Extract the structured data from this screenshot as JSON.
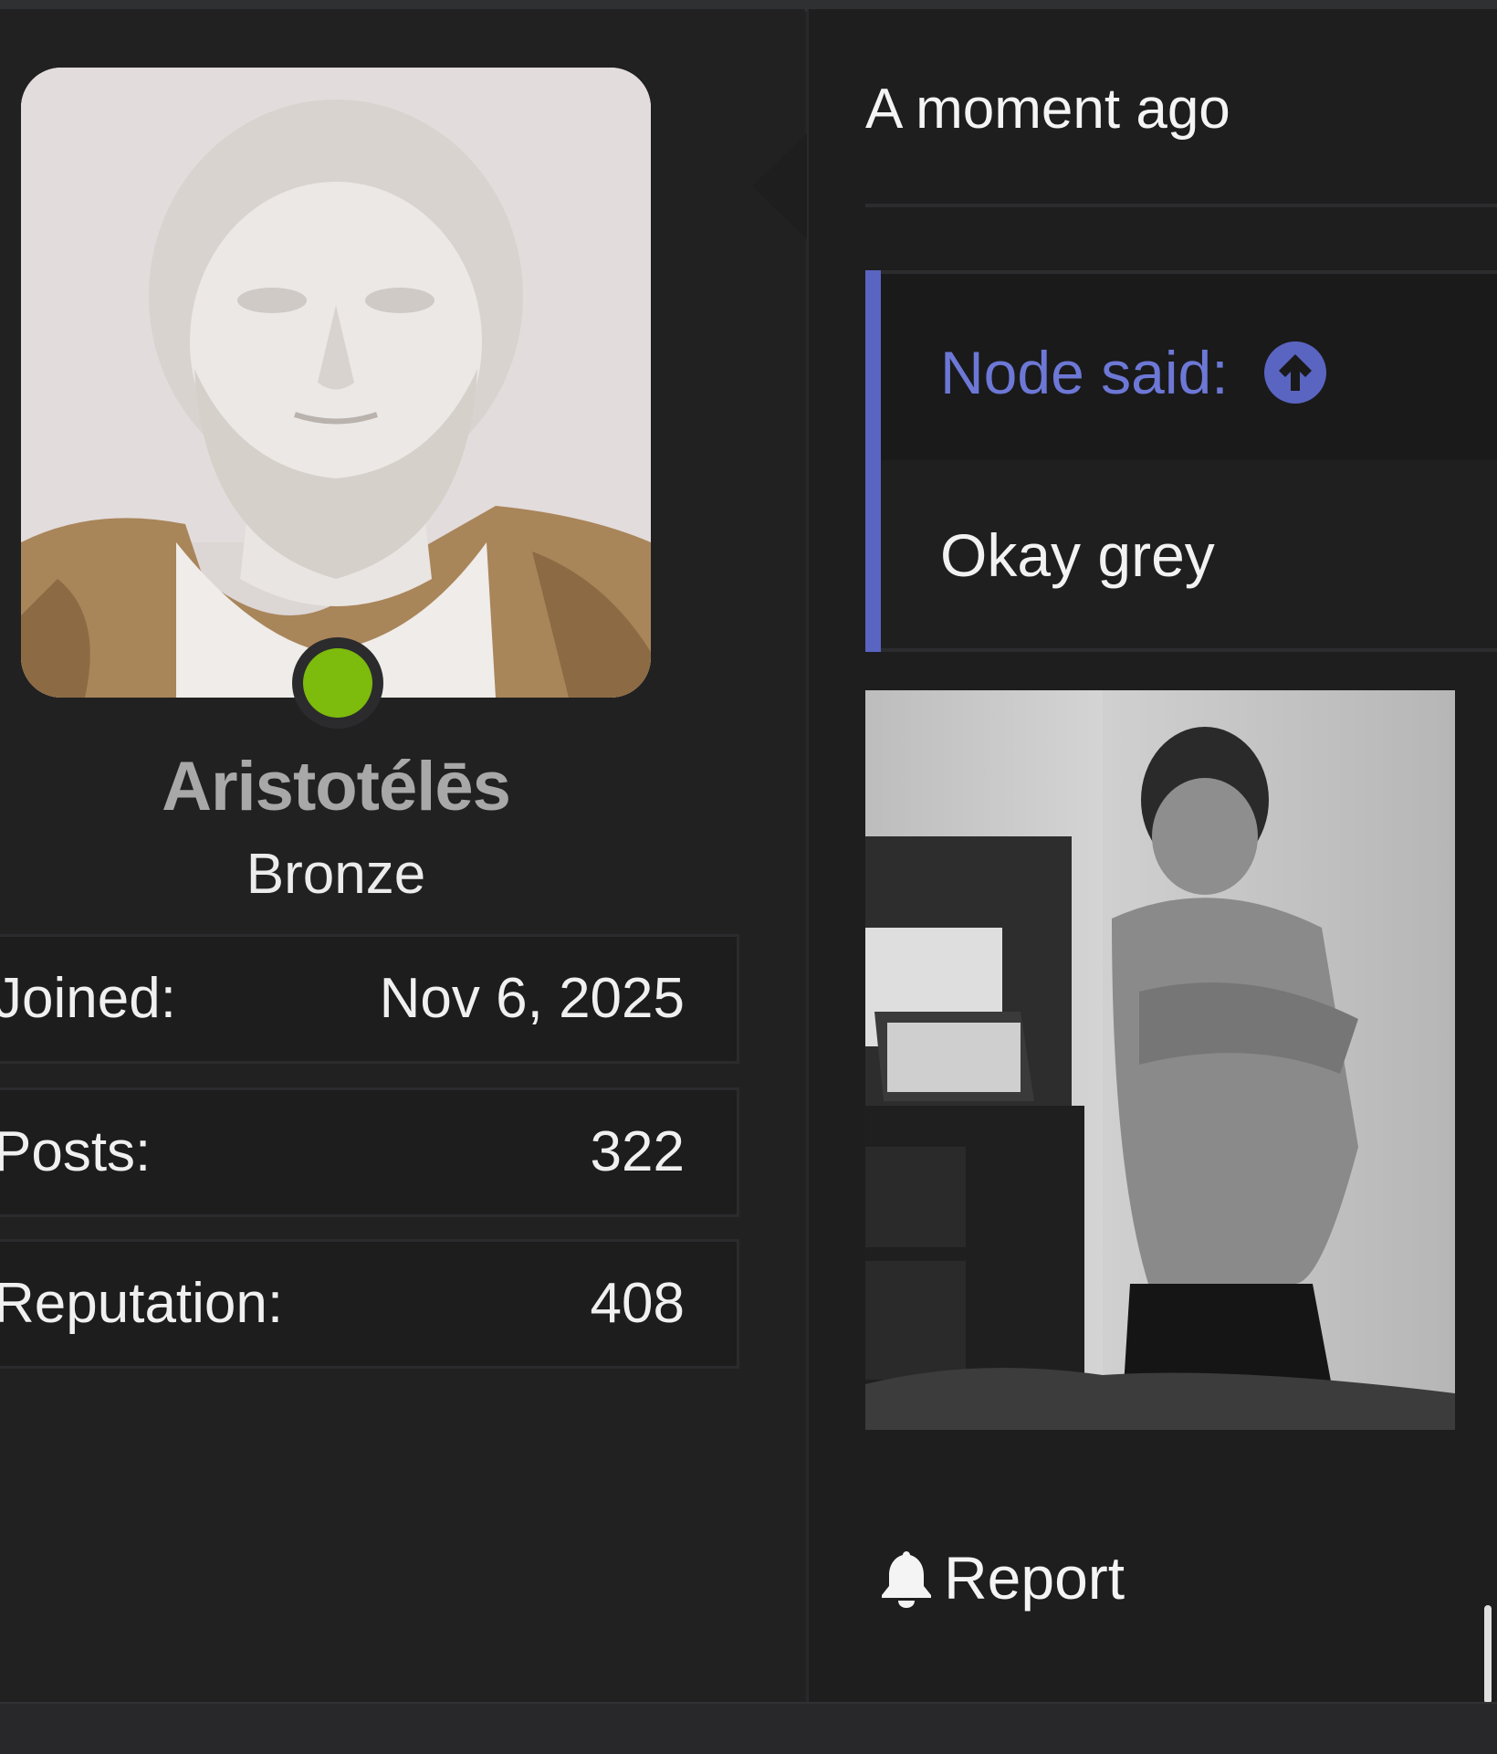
{
  "post": {
    "timestamp": "A moment ago",
    "quote": {
      "author_label": "Node said:",
      "body": "Okay grey"
    },
    "actions": {
      "report_label": "Report"
    }
  },
  "author": {
    "username": "Aristotélēs",
    "rank": "Bronze",
    "online": true,
    "stats": [
      {
        "label": "Joined:",
        "value": "Nov 6, 2025"
      },
      {
        "label": "Posts:",
        "value": "322"
      },
      {
        "label": "Reputation:",
        "value": "408"
      }
    ]
  },
  "icons": {
    "jump_to_quote": "arrow-up-circle-icon",
    "report": "bell-icon",
    "online": "online-status-dot"
  },
  "colors": {
    "accent": "#5a64c1",
    "quote_author": "#6d78d6",
    "online": "#7dbb0c",
    "background": "#252526"
  }
}
